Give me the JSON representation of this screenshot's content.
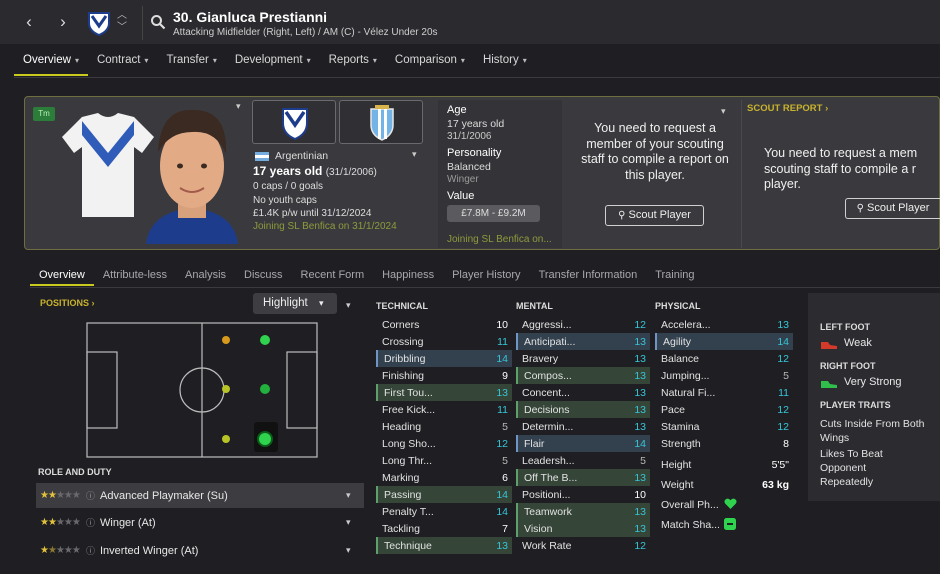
{
  "header": {
    "title": "30. Gianluca Prestianni",
    "subtitle": "Attacking Midfielder (Right, Left) / AM (C) - Vélez Under 20s",
    "nav_back": "‹",
    "nav_forward": "›"
  },
  "main_tabs": [
    {
      "label": "Overview"
    },
    {
      "label": "Contract"
    },
    {
      "label": "Transfer"
    },
    {
      "label": "Development"
    },
    {
      "label": "Reports"
    },
    {
      "label": "Comparison"
    },
    {
      "label": "History"
    }
  ],
  "profile": {
    "badge": "Tm",
    "nationality": "Argentinian",
    "age_big": "17 years old",
    "dob_short": "(31/1/2006)",
    "caps": "0 caps / 0 goals",
    "youth_caps": "No youth caps",
    "wage": "£1.4K p/w until 31/12/2024",
    "joining": "Joining SL Benfica on 31/1/2024"
  },
  "attributes_box": {
    "age_label": "Age",
    "age_value": "17 years old",
    "dob": "31/1/2006",
    "personality_label": "Personality",
    "personality_value": "Balanced",
    "media_value": "Winger",
    "value_label": "Value",
    "value_range": "£7.8M - £9.2M",
    "joining": "Joining SL Benfica on..."
  },
  "scout": {
    "request_text": "You need to request a member of your scouting staff to compile a report on this player.",
    "request_text_right": "You need to request a mem scouting staff to compile a r player.",
    "button_label": "Scout Player",
    "report_label": "SCOUT REPORT"
  },
  "sub_tabs": [
    {
      "label": "Overview"
    },
    {
      "label": "Attribute-less"
    },
    {
      "label": "Analysis"
    },
    {
      "label": "Discuss"
    },
    {
      "label": "Recent Form"
    },
    {
      "label": "Happiness"
    },
    {
      "label": "Player History"
    },
    {
      "label": "Transfer Information"
    },
    {
      "label": "Training"
    }
  ],
  "positions": {
    "label": "POSITIONS",
    "highlight_label": "Highlight",
    "role_label": "ROLE AND DUTY",
    "roles": [
      {
        "name": "Advanced Playmaker (Su)",
        "stars": 2,
        "half": false,
        "selected": true
      },
      {
        "name": "Winger (At)",
        "stars": 2,
        "half": false,
        "selected": false
      },
      {
        "name": "Inverted Winger (At)",
        "stars": 1,
        "half": true,
        "selected": false
      }
    ]
  },
  "technical": {
    "label": "TECHNICAL",
    "rows": [
      {
        "name": "Corners",
        "value": "10",
        "hl": "",
        "c": "white"
      },
      {
        "name": "Crossing",
        "value": "11",
        "hl": "",
        "c": "cyan"
      },
      {
        "name": "Dribbling",
        "value": "14",
        "hl": "blue",
        "c": "cyan"
      },
      {
        "name": "Finishing",
        "value": "9",
        "hl": "",
        "c": "white"
      },
      {
        "name": "First Tou...",
        "value": "13",
        "hl": "green",
        "c": "cyan"
      },
      {
        "name": "Free Kick...",
        "value": "11",
        "hl": "",
        "c": "cyan"
      },
      {
        "name": "Heading",
        "value": "5",
        "hl": "",
        "c": "grey"
      },
      {
        "name": "Long Sho...",
        "value": "12",
        "hl": "",
        "c": "cyan"
      },
      {
        "name": "Long Thr...",
        "value": "5",
        "hl": "",
        "c": "grey"
      },
      {
        "name": "Marking",
        "value": "6",
        "hl": "",
        "c": "white"
      },
      {
        "name": "Passing",
        "value": "14",
        "hl": "green",
        "c": "cyan"
      },
      {
        "name": "Penalty T...",
        "value": "14",
        "hl": "",
        "c": "cyan"
      },
      {
        "name": "Tackling",
        "value": "7",
        "hl": "",
        "c": "white"
      },
      {
        "name": "Technique",
        "value": "13",
        "hl": "green",
        "c": "cyan"
      }
    ]
  },
  "mental": {
    "label": "MENTAL",
    "rows": [
      {
        "name": "Aggressi...",
        "value": "12",
        "hl": "",
        "c": "cyan"
      },
      {
        "name": "Anticipati...",
        "value": "13",
        "hl": "blue",
        "c": "cyan"
      },
      {
        "name": "Bravery",
        "value": "13",
        "hl": "",
        "c": "cyan"
      },
      {
        "name": "Compos...",
        "value": "13",
        "hl": "green",
        "c": "cyan"
      },
      {
        "name": "Concent...",
        "value": "13",
        "hl": "",
        "c": "cyan"
      },
      {
        "name": "Decisions",
        "value": "13",
        "hl": "green",
        "c": "cyan"
      },
      {
        "name": "Determin...",
        "value": "13",
        "hl": "",
        "c": "cyan"
      },
      {
        "name": "Flair",
        "value": "14",
        "hl": "blue",
        "c": "cyan"
      },
      {
        "name": "Leadersh...",
        "value": "5",
        "hl": "",
        "c": "grey"
      },
      {
        "name": "Off The B...",
        "value": "13",
        "hl": "green",
        "c": "cyan"
      },
      {
        "name": "Positioni...",
        "value": "10",
        "hl": "",
        "c": "white"
      },
      {
        "name": "Teamwork",
        "value": "13",
        "hl": "green",
        "c": "cyan"
      },
      {
        "name": "Vision",
        "value": "13",
        "hl": "green",
        "c": "cyan"
      },
      {
        "name": "Work Rate",
        "value": "12",
        "hl": "",
        "c": "cyan"
      }
    ]
  },
  "physical": {
    "label": "PHYSICAL",
    "rows": [
      {
        "name": "Accelera...",
        "value": "13",
        "hl": "",
        "c": "cyan"
      },
      {
        "name": "Agility",
        "value": "14",
        "hl": "blue",
        "c": "cyan"
      },
      {
        "name": "Balance",
        "value": "12",
        "hl": "",
        "c": "cyan"
      },
      {
        "name": "Jumping...",
        "value": "5",
        "hl": "",
        "c": "grey"
      },
      {
        "name": "Natural Fi...",
        "value": "11",
        "hl": "",
        "c": "cyan"
      },
      {
        "name": "Pace",
        "value": "12",
        "hl": "",
        "c": "cyan"
      },
      {
        "name": "Stamina",
        "value": "12",
        "hl": "",
        "c": "cyan"
      },
      {
        "name": "Strength",
        "value": "8",
        "hl": "",
        "c": "white"
      }
    ],
    "height_label": "Height",
    "height_value": "5'5\"",
    "weight_label": "Weight",
    "weight_value": "63 kg",
    "overall_label": "Overall Ph...",
    "match_label": "Match Sha..."
  },
  "side": {
    "left_foot_label": "LEFT FOOT",
    "left_foot_value": "Weak",
    "right_foot_label": "RIGHT FOOT",
    "right_foot_value": "Very Strong",
    "traits_label": "PLAYER TRAITS",
    "traits": [
      "Cuts Inside From Both Wings",
      "Likes To Beat Opponent Repeatedly"
    ]
  },
  "colors": {
    "accent": "#c9c920",
    "cyan_value": "#35c6d8",
    "heading_gold": "#c9b32c",
    "joining_olive": "#8f9a3b"
  }
}
